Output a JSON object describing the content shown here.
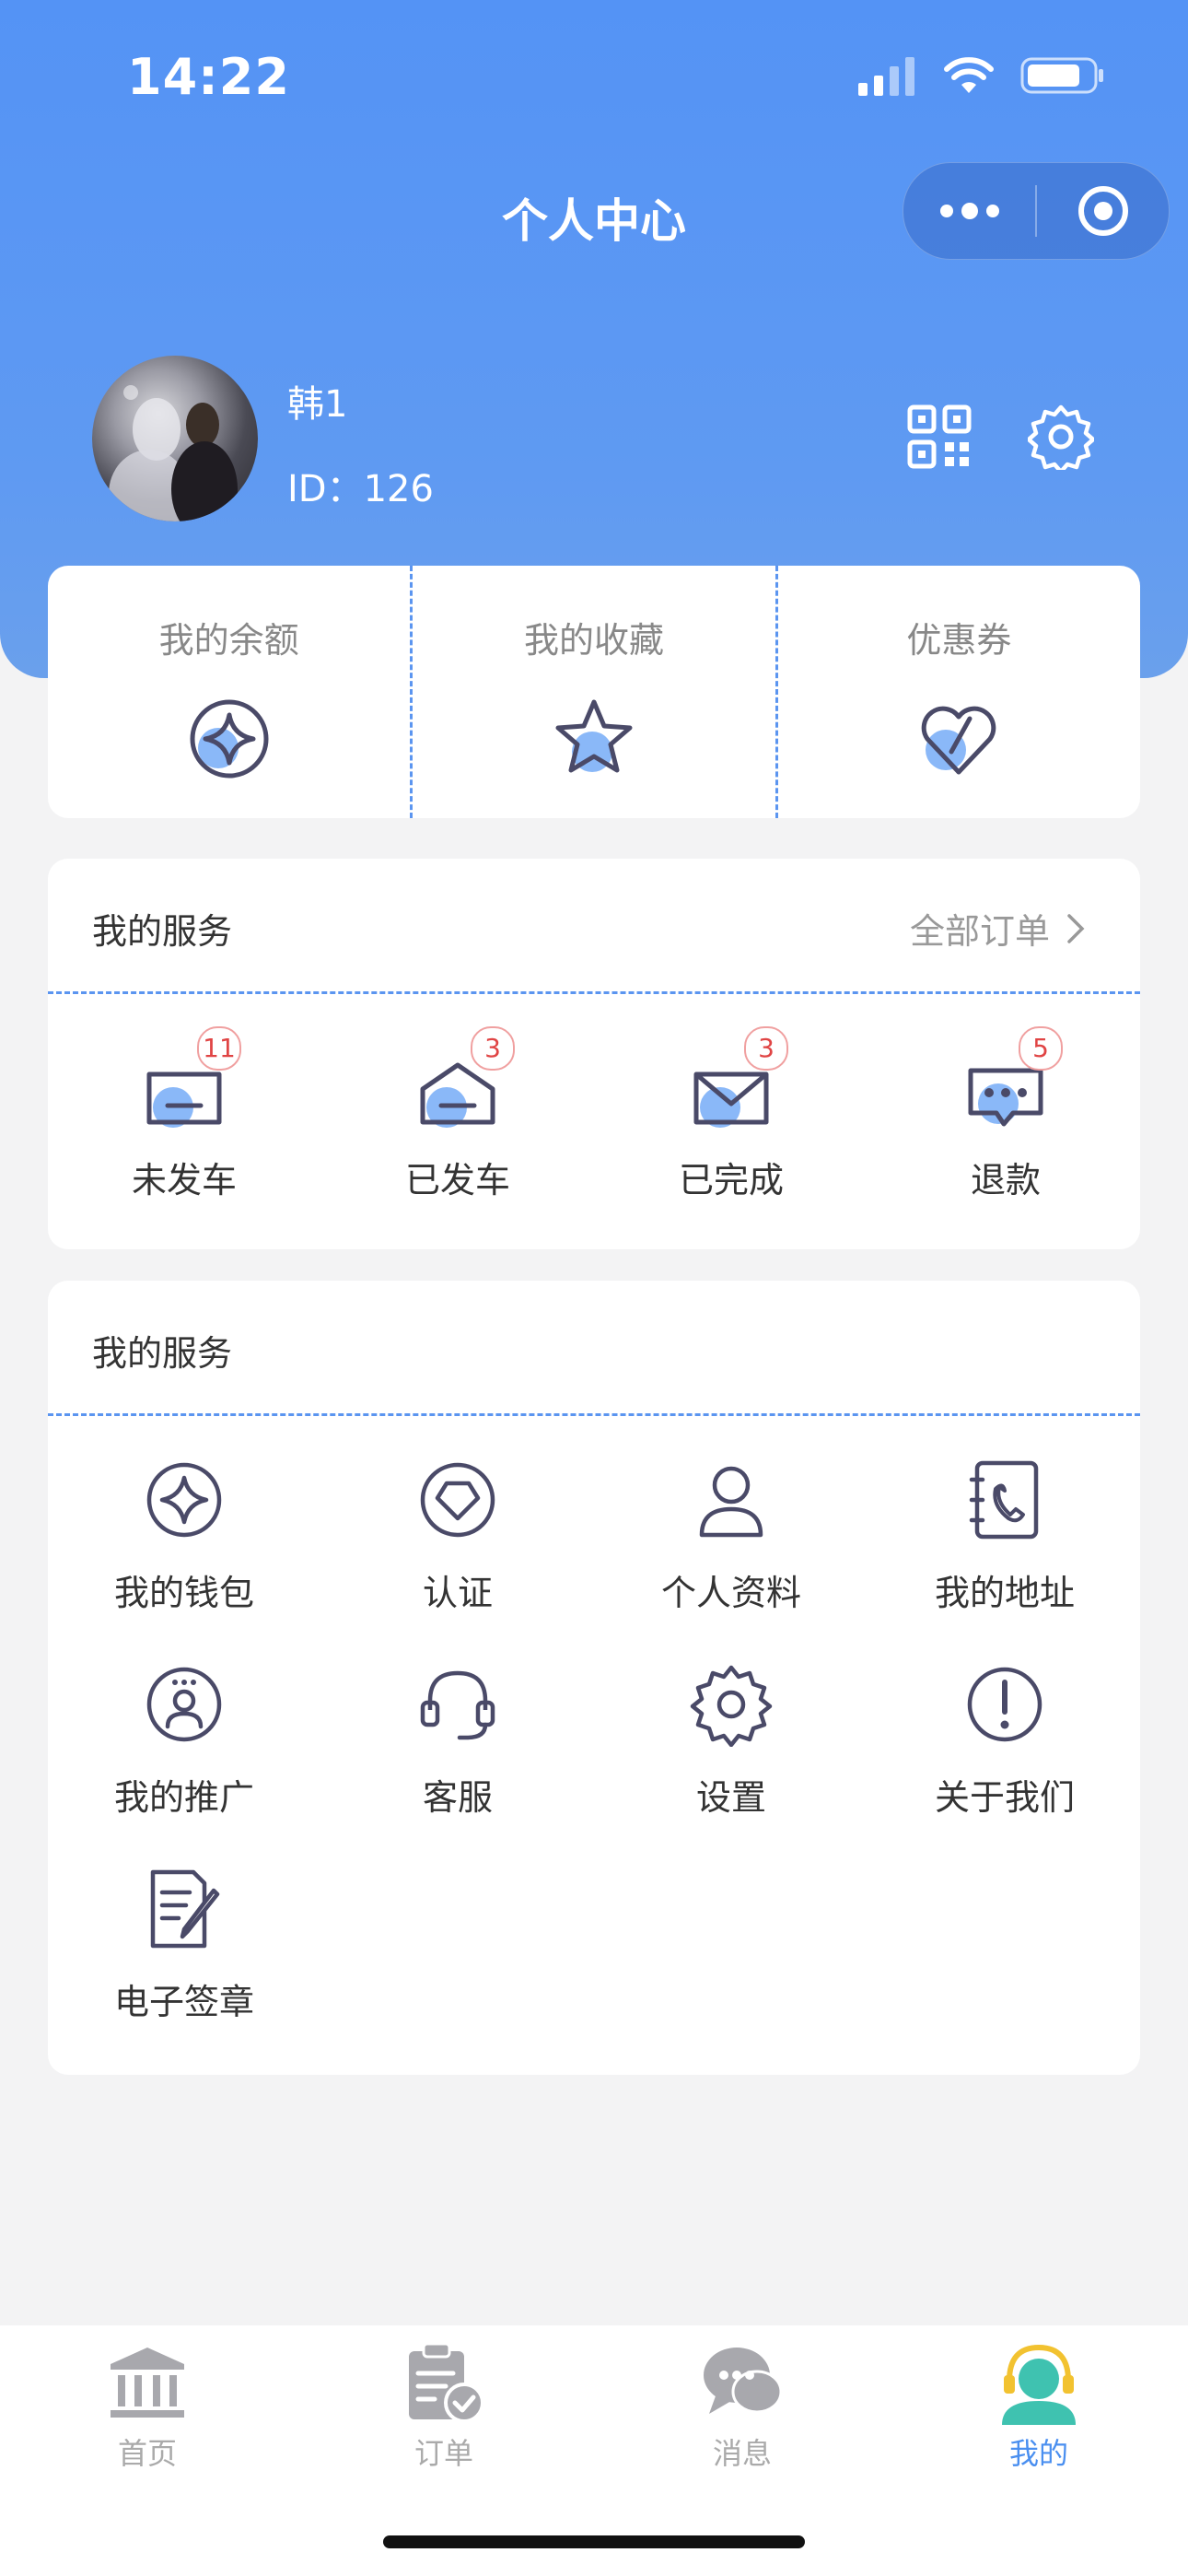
{
  "status_bar": {
    "time": "14:22"
  },
  "header": {
    "title": "个人中心"
  },
  "user": {
    "name": "韩1",
    "id_text": "ID：126"
  },
  "quick_links": [
    {
      "label": "我的余额",
      "icon": "balance-icon"
    },
    {
      "label": "我的收藏",
      "icon": "star-icon"
    },
    {
      "label": "优惠券",
      "icon": "coupon-heart-icon"
    }
  ],
  "orders": {
    "title": "我的服务",
    "more_label": "全部订单",
    "items": [
      {
        "label": "未发车",
        "badge": "11",
        "icon": "envelope-flat-icon"
      },
      {
        "label": "已发车",
        "badge": "3",
        "icon": "envelope-open-icon"
      },
      {
        "label": "已完成",
        "badge": "3",
        "icon": "envelope-check-icon"
      },
      {
        "label": "退款",
        "badge": "5",
        "icon": "chat-dots-icon"
      }
    ]
  },
  "services": {
    "title": "我的服务",
    "items": [
      {
        "label": "我的钱包",
        "icon": "wallet-icon"
      },
      {
        "label": "认证",
        "icon": "verify-icon"
      },
      {
        "label": "个人资料",
        "icon": "person-icon"
      },
      {
        "label": "我的地址",
        "icon": "address-book-icon"
      },
      {
        "label": "我的推广",
        "icon": "promote-icon"
      },
      {
        "label": "客服",
        "icon": "headset-icon"
      },
      {
        "label": "设置",
        "icon": "settings-icon"
      },
      {
        "label": "关于我们",
        "icon": "info-icon"
      },
      {
        "label": "电子签章",
        "icon": "e-sign-icon"
      }
    ]
  },
  "tabbar": {
    "items": [
      {
        "label": "首页",
        "icon": "bank-icon"
      },
      {
        "label": "订单",
        "icon": "clipboard-check-icon"
      },
      {
        "label": "消息",
        "icon": "chat-bubbles-icon"
      },
      {
        "label": "我的",
        "icon": "user-headset-icon"
      }
    ],
    "active": "我的"
  },
  "colors": {
    "accent": "#4a8ff0",
    "header": "#5493f5",
    "icon_stroke": "#4a4a68",
    "icon_fill": "#8ab8f8",
    "badge": "#e04444"
  }
}
